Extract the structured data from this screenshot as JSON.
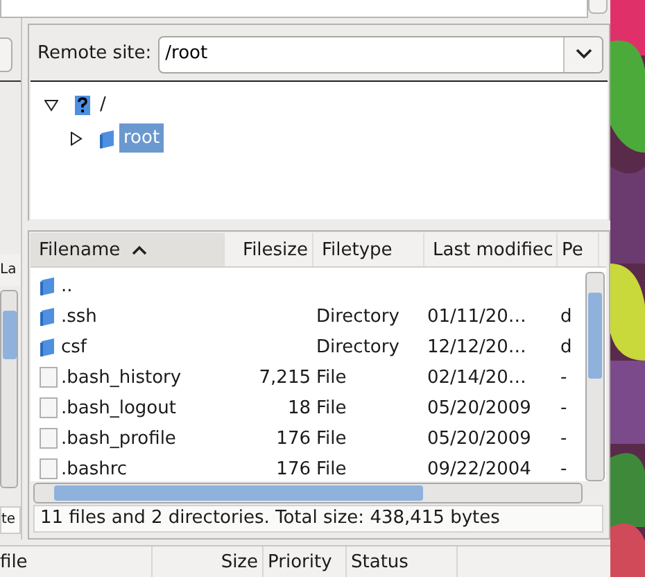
{
  "local_pane": {
    "header_fragment": "La",
    "status_fragment": "te"
  },
  "remote_site": {
    "label": "Remote site:",
    "value": "/root"
  },
  "tree": [
    {
      "label": "/",
      "kind": "drive",
      "expanded": true,
      "selected": false,
      "children": [
        {
          "label": "root",
          "kind": "folder",
          "expanded": false,
          "selected": true
        }
      ]
    }
  ],
  "file_list": {
    "columns": [
      {
        "label": "Filename",
        "sorted": true
      },
      {
        "label": "Filesize",
        "sorted": false
      },
      {
        "label": "Filetype",
        "sorted": false
      },
      {
        "label": "Last modifiec",
        "sorted": false
      },
      {
        "label": "Pe",
        "sorted": false
      }
    ],
    "rows": [
      {
        "kind": "folder",
        "filename": "..",
        "filesize": "",
        "filetype": "",
        "last_modified": "",
        "column_5": ""
      },
      {
        "kind": "folder",
        "filename": ".ssh",
        "filesize": "",
        "filetype": "Directory",
        "last_modified": "01/11/20…",
        "column_5": "d"
      },
      {
        "kind": "folder",
        "filename": "csf",
        "filesize": "",
        "filetype": "Directory",
        "last_modified": "12/12/20…",
        "column_5": "d"
      },
      {
        "kind": "file",
        "filename": ".bash_history",
        "filesize": "7,215",
        "filetype": "File",
        "last_modified": "02/14/20…",
        "column_5": "-"
      },
      {
        "kind": "file",
        "filename": ".bash_logout",
        "filesize": "18",
        "filetype": "File",
        "last_modified": "05/20/2009",
        "column_5": "-"
      },
      {
        "kind": "file",
        "filename": ".bash_profile",
        "filesize": "176",
        "filetype": "File",
        "last_modified": "05/20/2009",
        "column_5": "-"
      },
      {
        "kind": "file",
        "filename": ".bashrc",
        "filesize": "176",
        "filetype": "File",
        "last_modified": "09/22/2004",
        "column_5": "-"
      }
    ],
    "status": "11 files and 2 directories. Total size: 438,415 bytes"
  },
  "queue": {
    "columns": [
      "file",
      "Size",
      "Priority",
      "Status"
    ]
  }
}
